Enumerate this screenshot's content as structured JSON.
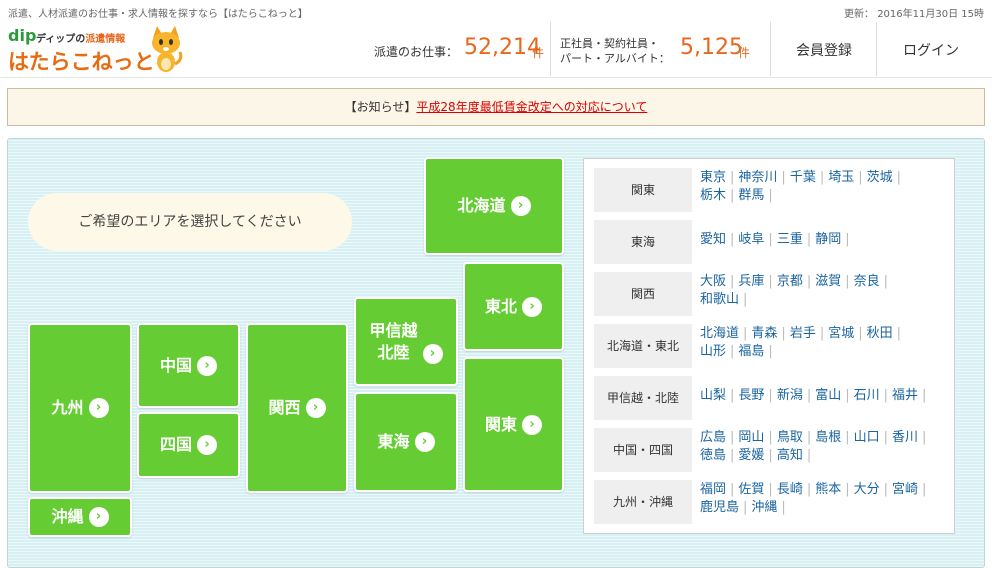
{
  "topline": {
    "description": "派遣、人材派遣のお仕事・求人情報を探すなら【はたらこねっと】",
    "updated": "更新： 2016年11月30日 15時"
  },
  "logo": {
    "dip": "dip",
    "sub_prefix": "ディップの",
    "sub_highlight": "派遣情報",
    "brand": "はたらこねっと"
  },
  "stats": {
    "haken_label": "派遣のお仕事：",
    "haken_count": "52,214",
    "haken_unit": "件",
    "other_label_line1": "正社員・契約社員・",
    "other_label_line2": "パート・アルバイト：",
    "other_count": "5,125",
    "other_unit": "件"
  },
  "nav": {
    "register": "会員登録",
    "login": "ログイン"
  },
  "notice": {
    "prefix": "【お知らせ】",
    "link": "平成28年度最低賃金改定への対応について"
  },
  "map": {
    "prompt": "ご希望のエリアを選択してください",
    "arrow": "›",
    "regions": {
      "hokkaido": "北海道",
      "tohoku": "東北",
      "koshinetsu_l1": "甲信越",
      "koshinetsu_l2": "北陸",
      "kanto": "関東",
      "tokai": "東海",
      "kansai": "関西",
      "chugoku": "中国",
      "shikoku": "四国",
      "kyushu": "九州",
      "okinawa": "沖縄"
    }
  },
  "areas": [
    {
      "name": "関東",
      "prefs": [
        "東京",
        "神奈川",
        "千葉",
        "埼玉",
        "茨城",
        "栃木",
        "群馬"
      ]
    },
    {
      "name": "東海",
      "prefs": [
        "愛知",
        "岐阜",
        "三重",
        "静岡"
      ]
    },
    {
      "name": "関西",
      "prefs": [
        "大阪",
        "兵庫",
        "京都",
        "滋賀",
        "奈良",
        "和歌山"
      ]
    },
    {
      "name": "北海道・東北",
      "prefs": [
        "北海道",
        "青森",
        "岩手",
        "宮城",
        "秋田",
        "山形",
        "福島"
      ]
    },
    {
      "name": "甲信越・北陸",
      "prefs": [
        "山梨",
        "長野",
        "新潟",
        "富山",
        "石川",
        "福井"
      ]
    },
    {
      "name": "中国・四国",
      "prefs": [
        "広島",
        "岡山",
        "鳥取",
        "島根",
        "山口",
        "香川",
        "徳島",
        "愛媛",
        "高知"
      ]
    },
    {
      "name": "九州・沖縄",
      "prefs": [
        "福岡",
        "佐賀",
        "長崎",
        "熊本",
        "大分",
        "宮崎",
        "鹿児島",
        "沖縄"
      ]
    }
  ],
  "colors": {
    "accent_orange": "#e8671d",
    "region_green": "#66cc33",
    "link_blue": "#1a64a0",
    "notice_red": "#dd0000",
    "map_bg": "#d6f0f3"
  }
}
